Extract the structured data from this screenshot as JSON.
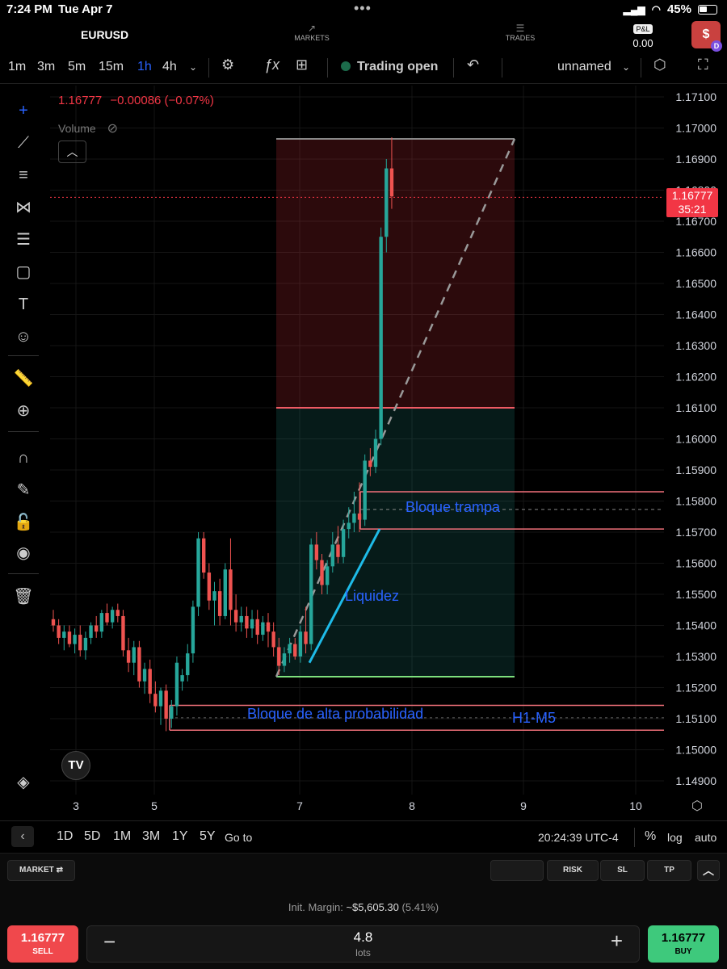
{
  "status": {
    "time": "7:24 PM",
    "date": "Tue Apr 7",
    "battery": "45%"
  },
  "app": {
    "symbol": "EURUSD",
    "markets_label": "MARKETS",
    "trades_label": "TRADES",
    "pnl_label": "P&L",
    "pnl_value": "0.00",
    "avatar_letter": "$",
    "avatar_badge": "D"
  },
  "toolbar": {
    "timeframes": [
      "1m",
      "3m",
      "5m",
      "15m",
      "1h",
      "4h"
    ],
    "active_timeframe": "1h",
    "trading_status": "Trading open",
    "layout_name": "unnamed"
  },
  "chart_legend": {
    "price": "1.16777",
    "change": "−0.00086 (−0.07%)",
    "volume_label": "Volume"
  },
  "price_label": {
    "price": "1.16777",
    "countdown": "35:21"
  },
  "price_axis": [
    "1.17100",
    "1.17000",
    "1.16900",
    "1.16800",
    "1.16700",
    "1.16600",
    "1.16500",
    "1.16400",
    "1.16300",
    "1.16200",
    "1.16100",
    "1.16000",
    "1.15900",
    "1.15800",
    "1.15700",
    "1.15600",
    "1.15500",
    "1.15400",
    "1.15300",
    "1.15200",
    "1.15100",
    "1.15000",
    "1.14900"
  ],
  "time_axis": [
    "3",
    "5",
    "7",
    "8",
    "9",
    "10"
  ],
  "annotations": {
    "trap": "Bloque trampa",
    "liquidity": "Liquidez",
    "high_prob": "Bloque de alta probabilidad",
    "tf": "H1-M5"
  },
  "range_bar": {
    "ranges": [
      "1D",
      "5D",
      "1M",
      "3M",
      "1Y",
      "5Y"
    ],
    "goto": "Go to",
    "clock": "20:24:39 UTC-4",
    "percent": "%",
    "log": "log",
    "auto": "auto"
  },
  "order_bar": {
    "market": "MARKET",
    "risk": "RISK",
    "sl": "SL",
    "tp": "TP"
  },
  "bottom": {
    "margin_label": "Init. Margin:",
    "margin_value": "~$5,605.30",
    "margin_pct": "(5.41%)",
    "sell_price": "1.16777",
    "sell_label": "SELL",
    "lots_value": "4.8",
    "lots_label": "lots",
    "buy_price": "1.16777",
    "buy_label": "BUY"
  },
  "colors": {
    "up": "#26a69a",
    "down": "#ef5350",
    "accent": "#2962ff",
    "annotation": "#2962ff",
    "liquidity_line": "#1ebbe8"
  }
}
